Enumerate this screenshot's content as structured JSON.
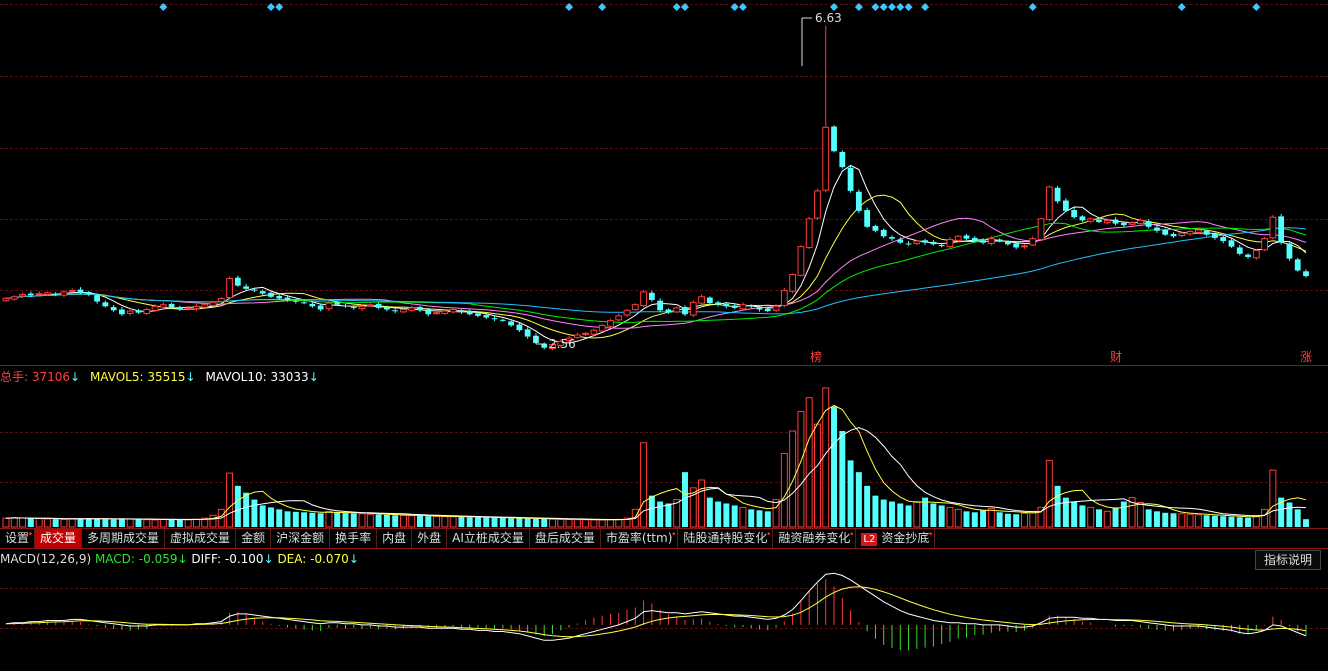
{
  "price_annotations": {
    "high": "6.63",
    "low": "2.56"
  },
  "event_markers": [
    "榜",
    "财",
    "涨"
  ],
  "volume_legend": {
    "total_label": "总手: ",
    "total_value": "37106",
    "total_arrow": "↓",
    "ma5_label": "MAVOL5: ",
    "ma5_value": "35515",
    "ma5_arrow": "↓",
    "ma10_label": "MAVOL10: ",
    "ma10_value": "33033",
    "ma10_arrow": "↓"
  },
  "tabs": [
    {
      "label": "设置",
      "active": false,
      "dot": true
    },
    {
      "label": "成交量",
      "active": true,
      "dot": false
    },
    {
      "label": "多周期成交量",
      "active": false,
      "dot": false
    },
    {
      "label": "虚拟成交量",
      "active": false,
      "dot": false
    },
    {
      "label": "金额",
      "active": false,
      "dot": false
    },
    {
      "label": "沪深金额",
      "active": false,
      "dot": false
    },
    {
      "label": "换手率",
      "active": false,
      "dot": false
    },
    {
      "label": "内盘",
      "active": false,
      "dot": false
    },
    {
      "label": "外盘",
      "active": false,
      "dot": false
    },
    {
      "label": "AI立桩成交量",
      "active": false,
      "dot": false
    },
    {
      "label": "盘后成交量",
      "active": false,
      "dot": false
    },
    {
      "label": "市盈率(ttm)",
      "active": false,
      "dot": true
    },
    {
      "label": "陆股通持股变化",
      "active": false,
      "dot": true
    },
    {
      "label": "融资融券变化",
      "active": false,
      "dot": true
    },
    {
      "label": "资金抄底",
      "active": false,
      "dot": true,
      "badge": "L2"
    }
  ],
  "macd_legend": {
    "name": "MACD(12,26,9)",
    "macd_label": " MACD: ",
    "macd_value": "-0.059",
    "macd_arrow": "↓",
    "diff_label": " DIFF: ",
    "diff_value": "-0.100",
    "diff_arrow": "↓",
    "dea_label": " DEA: ",
    "dea_value": "-0.070",
    "dea_arrow": "↓"
  },
  "help_button": "指标说明",
  "colors": {
    "up": "#ff3a3a",
    "down": "#54ffff",
    "ma5": "#ffffff",
    "ma10": "#ffff40",
    "ma20": "#ff80ff",
    "ma30": "#00ee00",
    "ma60": "#20c0ff",
    "diff": "#ffffff",
    "dea": "#ffff40",
    "grid": "#5a0d0d",
    "marker": "#3cc8ff"
  },
  "chart_data": [
    {
      "type": "candlestick",
      "ylim": [
        2.4,
        6.9
      ],
      "high": 6.63,
      "low": 2.56,
      "close": [
        3.2,
        3.22,
        3.25,
        3.24,
        3.26,
        3.27,
        3.25,
        3.28,
        3.3,
        3.27,
        3.25,
        3.16,
        3.1,
        3.05,
        3.0,
        3.04,
        3.02,
        3.06,
        3.1,
        3.12,
        3.08,
        3.06,
        3.08,
        3.1,
        3.12,
        3.15,
        3.2,
        3.45,
        3.36,
        3.32,
        3.3,
        3.26,
        3.22,
        3.2,
        3.18,
        3.16,
        3.14,
        3.1,
        3.06,
        3.14,
        3.12,
        3.1,
        3.08,
        3.1,
        3.12,
        3.08,
        3.06,
        3.04,
        3.06,
        3.08,
        3.05,
        3.0,
        3.02,
        3.04,
        3.06,
        3.03,
        3.0,
        2.98,
        2.96,
        2.94,
        2.92,
        2.86,
        2.8,
        2.72,
        2.64,
        2.58,
        2.62,
        2.66,
        2.7,
        2.74,
        2.76,
        2.8,
        2.86,
        2.92,
        2.98,
        3.05,
        3.12,
        3.28,
        3.18,
        3.05,
        3.02,
        3.08,
        3.0,
        3.15,
        3.22,
        3.14,
        3.12,
        3.1,
        3.08,
        3.12,
        3.1,
        3.06,
        3.04,
        3.1,
        3.3,
        3.5,
        3.85,
        4.2,
        4.55,
        5.35,
        5.05,
        4.85,
        4.55,
        4.3,
        4.1,
        4.05,
        3.98,
        3.95,
        3.9,
        3.88,
        3.92,
        3.9,
        3.88,
        3.86,
        3.94,
        3.98,
        3.95,
        3.92,
        3.9,
        3.95,
        3.92,
        3.88,
        3.84,
        3.86,
        3.95,
        4.2,
        4.6,
        4.42,
        4.3,
        4.22,
        4.18,
        4.2,
        4.16,
        4.18,
        4.14,
        4.12,
        4.15,
        4.18,
        4.1,
        4.05,
        4.0,
        3.98,
        4.02,
        4.04,
        4.06,
        4.0,
        3.96,
        3.92,
        3.85,
        3.76,
        3.72,
        3.8,
        3.95,
        4.22,
        3.9,
        3.7,
        3.55,
        3.48
      ]
    },
    {
      "type": "bar",
      "title": "成交量",
      "ylim": [
        0,
        146000
      ],
      "values": [
        9000,
        9500,
        9200,
        8800,
        8500,
        8200,
        8000,
        7800,
        8200,
        8600,
        9000,
        8400,
        8000,
        7600,
        8400,
        8200,
        7800,
        7400,
        7200,
        7800,
        8000,
        7600,
        7400,
        7800,
        9000,
        12000,
        18000,
        55000,
        42000,
        35000,
        28000,
        22000,
        20000,
        18000,
        16000,
        15500,
        15000,
        14500,
        14000,
        16000,
        15000,
        14200,
        13800,
        13500,
        13000,
        12800,
        12400,
        12000,
        11800,
        11500,
        11200,
        11000,
        10800,
        10600,
        10400,
        10200,
        10000,
        9800,
        9600,
        9400,
        9200,
        9000,
        8800,
        8600,
        8400,
        8200,
        8000,
        7800,
        7600,
        7500,
        7400,
        7300,
        7200,
        7400,
        7800,
        9000,
        18000,
        86000,
        32000,
        26000,
        24000,
        28000,
        56000,
        40000,
        48000,
        30000,
        26000,
        24000,
        22000,
        20000,
        18000,
        17000,
        16000,
        28000,
        75000,
        98000,
        118000,
        132000,
        105000,
        142000,
        123000,
        98000,
        68000,
        56000,
        42000,
        32000,
        28000,
        26000,
        24000,
        22000,
        26000,
        30000,
        24000,
        22000,
        20000,
        18000,
        16000,
        15000,
        17000,
        19000,
        15000,
        13500,
        13000,
        14000,
        16000,
        20000,
        68000,
        42000,
        30000,
        26000,
        22000,
        20000,
        18000,
        16000,
        20000,
        26000,
        30000,
        25000,
        18000,
        16000,
        14500,
        14000,
        13500,
        13000,
        12500,
        12000,
        11500,
        11000,
        10500,
        10000,
        9500,
        11000,
        18000,
        58000,
        30000,
        25000,
        18000,
        8000
      ]
    },
    {
      "type": "bar",
      "title": "MACD(12,26,9)",
      "ylim": [
        -0.42,
        0.5
      ],
      "diff": [
        0.01,
        0.02,
        0.02,
        0.03,
        0.03,
        0.04,
        0.04,
        0.04,
        0.05,
        0.05,
        0.04,
        0.03,
        0.02,
        0.01,
        0.0,
        -0.01,
        -0.01,
        -0.01,
        0.0,
        0.0,
        0.0,
        0.0,
        0.0,
        0.01,
        0.01,
        0.02,
        0.03,
        0.08,
        0.1,
        0.1,
        0.09,
        0.08,
        0.07,
        0.06,
        0.05,
        0.04,
        0.03,
        0.02,
        0.01,
        0.02,
        0.02,
        0.01,
        0.01,
        0.0,
        0.0,
        -0.01,
        -0.01,
        -0.02,
        -0.02,
        -0.02,
        -0.02,
        -0.03,
        -0.03,
        -0.03,
        -0.03,
        -0.04,
        -0.04,
        -0.05,
        -0.05,
        -0.06,
        -0.06,
        -0.07,
        -0.08,
        -0.1,
        -0.12,
        -0.14,
        -0.14,
        -0.13,
        -0.12,
        -0.1,
        -0.08,
        -0.06,
        -0.04,
        -0.02,
        0.0,
        0.03,
        0.06,
        0.12,
        0.13,
        0.12,
        0.11,
        0.11,
        0.1,
        0.11,
        0.12,
        0.11,
        0.1,
        0.09,
        0.08,
        0.08,
        0.07,
        0.06,
        0.05,
        0.06,
        0.09,
        0.14,
        0.22,
        0.31,
        0.39,
        0.46,
        0.47,
        0.45,
        0.41,
        0.36,
        0.31,
        0.26,
        0.21,
        0.17,
        0.13,
        0.1,
        0.08,
        0.06,
        0.04,
        0.03,
        0.02,
        0.02,
        0.01,
        0.01,
        0.0,
        0.0,
        0.0,
        -0.01,
        -0.02,
        -0.02,
        -0.01,
        0.02,
        0.06,
        0.07,
        0.07,
        0.07,
        0.06,
        0.06,
        0.05,
        0.05,
        0.04,
        0.04,
        0.04,
        0.03,
        0.02,
        0.01,
        0.0,
        -0.01,
        -0.01,
        -0.01,
        -0.01,
        -0.02,
        -0.03,
        -0.04,
        -0.05,
        -0.07,
        -0.08,
        -0.07,
        -0.05,
        0.0,
        -0.01,
        -0.04,
        -0.07,
        -0.1
      ]
    }
  ]
}
